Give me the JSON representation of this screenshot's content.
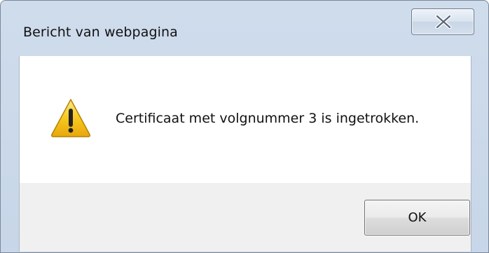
{
  "window": {
    "title": "Bericht van webpagina",
    "close_icon": "close-x-icon"
  },
  "dialog": {
    "icon": "warning-icon",
    "message": "Certificaat met volgnummer 3 is ingetrokken.",
    "ok_label": "OK"
  },
  "colors": {
    "frame": "#c9d8ea",
    "footer": "#f0f0f0",
    "warning_yellow": "#f4c620"
  }
}
